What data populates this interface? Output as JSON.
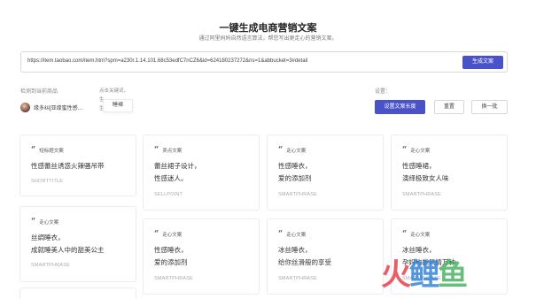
{
  "header": {
    "title": "一键生成电商营销文案",
    "subtitle": "通过阿里妈妈自然语言算法，帮您写出更走心的营销文案。"
  },
  "url_bar": {
    "value": "https://item.taobao.com/item.htm?spm=a230r.1.14.101.68c53edfC7nCZ6&id=624180237272&ns=1&abbucket=3#detail",
    "generate_label": "生成文案"
  },
  "detected": {
    "label": "检测到当前商品",
    "product_name": "缘多纠[亚缘蜜性感…"
  },
  "keywords": {
    "hint_line1": "点击关键词，",
    "hint_line2": "生",
    "hint_line3": "生",
    "chip_label": "睡裙"
  },
  "settings": {
    "label": "设置：",
    "length_button": "设置文案长度",
    "reset_button": "重置",
    "swap_button": "换一批"
  },
  "cards": [
    {
      "category": "短标题文案",
      "text": "性感蕾丝诱惑火辣骚吊带",
      "tag": "SHORTTITLE"
    },
    {
      "category": "卖点文案",
      "text": "蕾丝裙子设计，\n性感迷人。",
      "tag": "SELLPOINT"
    },
    {
      "category": "走心文案",
      "text": "性感睡衣，\n爱的添加剂",
      "tag": "SMARTPHRASE"
    },
    {
      "category": "走心文案",
      "text": "性感睡裙，\n演绎极致女人味",
      "tag": "SMARTPHRASE"
    },
    {
      "category": "走心文案",
      "text": "丝绸睡衣，\n成就睡美人中的甜美公主",
      "tag": "SMARTPHRASE"
    },
    {
      "category": "走心文案",
      "text": "性感睡衣，\n爱的添加剂",
      "tag": "SMARTPHRASE"
    },
    {
      "category": "走心文案",
      "text": "冰丝睡衣，\n给你丝滑般的享受",
      "tag": "SMARTPHRASE"
    },
    {
      "category": "走心文案",
      "text": "冰丝睡衣，\n孕妈也能风情万种",
      "tag": "SMARTPHRASE"
    }
  ],
  "watermark": {
    "part1": "火",
    "part2": "鲤",
    "part3": "鱼"
  },
  "colors": {
    "accent": "#4a52c8",
    "border": "#ececec"
  }
}
